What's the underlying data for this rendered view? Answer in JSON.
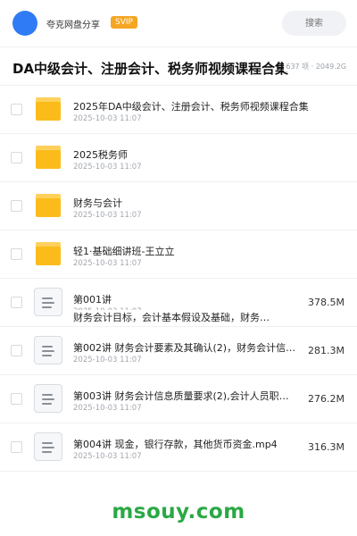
{
  "header": {
    "share_title": "夸克网盘分享",
    "badge": "SVIP",
    "search_placeholder": "搜索"
  },
  "folder": {
    "title": "DA中级会计、注册会计、税务师视频课程合集",
    "meta": "637 项 · 2049.2G"
  },
  "items": [
    {
      "type": "folder",
      "name": "2025年DA中级会计、注册会计、税务师视频课程合集",
      "date": "2025-10-03 11:07",
      "size": ""
    },
    {
      "type": "folder",
      "name": "2025税务师",
      "date": "2025-10-03 11:07",
      "size": ""
    },
    {
      "type": "folder",
      "name": "财务与会计",
      "date": "2025-10-03 11:07",
      "size": ""
    },
    {
      "type": "folder",
      "name": "轻1·基础细讲班-王立立",
      "date": "2025-10-03 11:07",
      "size": ""
    },
    {
      "type": "file",
      "name": "第001讲",
      "subtext": "财务会计目标，会计基本假设及基础，财务…",
      "date": "2025-10-03 11:07",
      "size": "378.5M"
    },
    {
      "type": "file",
      "name": "第002讲 财务会计要素及其确认(2)，财务会计信…",
      "date": "2025-10-03 11:07",
      "size": "281.3M"
    },
    {
      "type": "file",
      "name": "第003讲 财务会计信息质量要求(2),会计人员职…",
      "date": "2025-10-03 11:07",
      "size": "276.2M"
    },
    {
      "type": "file",
      "name": "第004讲 现金，银行存款，其他货币资金.mp4",
      "date": "2025-10-03 11:07",
      "size": "316.3M"
    }
  ],
  "footer": {
    "watermark": "msouy.com"
  },
  "colors": {
    "avatar": "#2f7bf5",
    "svip": "#f5a623",
    "folder": "#fbbc1b",
    "watermark": "#2aa845"
  }
}
